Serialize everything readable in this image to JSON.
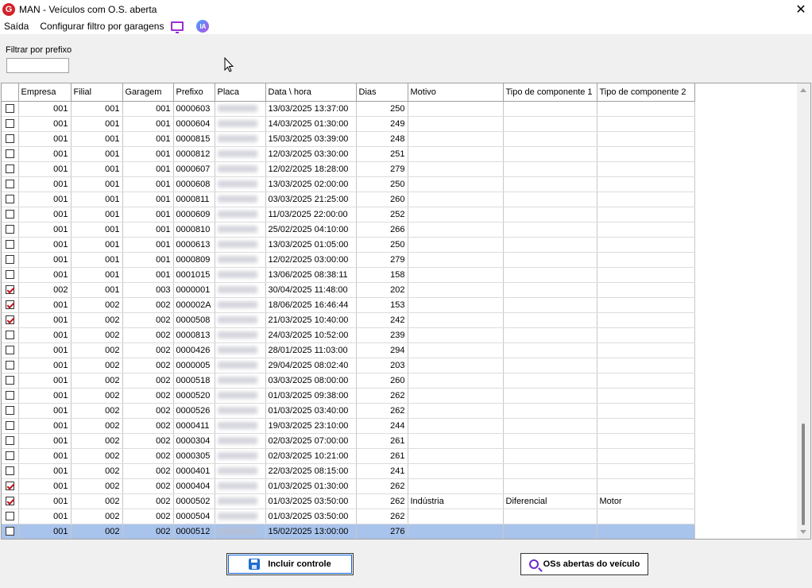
{
  "window": {
    "title": "MAN - Veículos com O.S. aberta",
    "logo_letter": "G"
  },
  "menu": {
    "exit": "Saída",
    "configure_filter": "Configurar filtro por garagens",
    "ia": "IA"
  },
  "filter": {
    "label": "Filtrar por prefixo",
    "value": ""
  },
  "table": {
    "columns": [
      "Empresa",
      "Filial",
      "Garagem",
      "Prefixo",
      "Placa",
      "Data \\ hora",
      "Dias",
      "Motivo",
      "Tipo de componente 1",
      "Tipo de componente 2"
    ],
    "rows": [
      {
        "checked": false,
        "empresa": "001",
        "filial": "001",
        "garagem": "001",
        "prefixo": "0000603",
        "data": "13/03/2025 13:37:00",
        "dias": "250",
        "motivo": "",
        "comp1": "",
        "comp2": ""
      },
      {
        "checked": false,
        "empresa": "001",
        "filial": "001",
        "garagem": "001",
        "prefixo": "0000604",
        "data": "14/03/2025 01:30:00",
        "dias": "249",
        "motivo": "",
        "comp1": "",
        "comp2": ""
      },
      {
        "checked": false,
        "empresa": "001",
        "filial": "001",
        "garagem": "001",
        "prefixo": "0000815",
        "data": "15/03/2025 03:39:00",
        "dias": "248",
        "motivo": "",
        "comp1": "",
        "comp2": ""
      },
      {
        "checked": false,
        "empresa": "001",
        "filial": "001",
        "garagem": "001",
        "prefixo": "0000812",
        "data": "12/03/2025 03:30:00",
        "dias": "251",
        "motivo": "",
        "comp1": "",
        "comp2": ""
      },
      {
        "checked": false,
        "empresa": "001",
        "filial": "001",
        "garagem": "001",
        "prefixo": "0000607",
        "data": "12/02/2025 18:28:00",
        "dias": "279",
        "motivo": "",
        "comp1": "",
        "comp2": ""
      },
      {
        "checked": false,
        "empresa": "001",
        "filial": "001",
        "garagem": "001",
        "prefixo": "0000608",
        "data": "13/03/2025 02:00:00",
        "dias": "250",
        "motivo": "",
        "comp1": "",
        "comp2": ""
      },
      {
        "checked": false,
        "empresa": "001",
        "filial": "001",
        "garagem": "001",
        "prefixo": "0000811",
        "data": "03/03/2025 21:25:00",
        "dias": "260",
        "motivo": "",
        "comp1": "",
        "comp2": ""
      },
      {
        "checked": false,
        "empresa": "001",
        "filial": "001",
        "garagem": "001",
        "prefixo": "0000609",
        "data": "11/03/2025 22:00:00",
        "dias": "252",
        "motivo": "",
        "comp1": "",
        "comp2": ""
      },
      {
        "checked": false,
        "empresa": "001",
        "filial": "001",
        "garagem": "001",
        "prefixo": "0000810",
        "data": "25/02/2025 04:10:00",
        "dias": "266",
        "motivo": "",
        "comp1": "",
        "comp2": ""
      },
      {
        "checked": false,
        "empresa": "001",
        "filial": "001",
        "garagem": "001",
        "prefixo": "0000613",
        "data": "13/03/2025 01:05:00",
        "dias": "250",
        "motivo": "",
        "comp1": "",
        "comp2": ""
      },
      {
        "checked": false,
        "empresa": "001",
        "filial": "001",
        "garagem": "001",
        "prefixo": "0000809",
        "data": "12/02/2025 03:00:00",
        "dias": "279",
        "motivo": "",
        "comp1": "",
        "comp2": ""
      },
      {
        "checked": false,
        "empresa": "001",
        "filial": "001",
        "garagem": "001",
        "prefixo": "0001015",
        "data": "13/06/2025 08:38:11",
        "dias": "158",
        "motivo": "",
        "comp1": "",
        "comp2": ""
      },
      {
        "checked": true,
        "empresa": "002",
        "filial": "001",
        "garagem": "003",
        "prefixo": "0000001",
        "data": "30/04/2025 11:48:00",
        "dias": "202",
        "motivo": "",
        "comp1": "",
        "comp2": ""
      },
      {
        "checked": true,
        "empresa": "001",
        "filial": "002",
        "garagem": "002",
        "prefixo": "000002A",
        "data": "18/06/2025 16:46:44",
        "dias": "153",
        "motivo": "",
        "comp1": "",
        "comp2": ""
      },
      {
        "checked": true,
        "empresa": "001",
        "filial": "002",
        "garagem": "002",
        "prefixo": "0000508",
        "data": "21/03/2025 10:40:00",
        "dias": "242",
        "motivo": "",
        "comp1": "",
        "comp2": ""
      },
      {
        "checked": false,
        "empresa": "001",
        "filial": "002",
        "garagem": "002",
        "prefixo": "0000813",
        "data": "24/03/2025 10:52:00",
        "dias": "239",
        "motivo": "",
        "comp1": "",
        "comp2": ""
      },
      {
        "checked": false,
        "empresa": "001",
        "filial": "002",
        "garagem": "002",
        "prefixo": "0000426",
        "data": "28/01/2025 11:03:00",
        "dias": "294",
        "motivo": "",
        "comp1": "",
        "comp2": ""
      },
      {
        "checked": false,
        "empresa": "001",
        "filial": "002",
        "garagem": "002",
        "prefixo": "0000005",
        "data": "29/04/2025 08:02:40",
        "dias": "203",
        "motivo": "",
        "comp1": "",
        "comp2": ""
      },
      {
        "checked": false,
        "empresa": "001",
        "filial": "002",
        "garagem": "002",
        "prefixo": "0000518",
        "data": "03/03/2025 08:00:00",
        "dias": "260",
        "motivo": "",
        "comp1": "",
        "comp2": ""
      },
      {
        "checked": false,
        "empresa": "001",
        "filial": "002",
        "garagem": "002",
        "prefixo": "0000520",
        "data": "01/03/2025 09:38:00",
        "dias": "262",
        "motivo": "",
        "comp1": "",
        "comp2": ""
      },
      {
        "checked": false,
        "empresa": "001",
        "filial": "002",
        "garagem": "002",
        "prefixo": "0000526",
        "data": "01/03/2025 03:40:00",
        "dias": "262",
        "motivo": "",
        "comp1": "",
        "comp2": ""
      },
      {
        "checked": false,
        "empresa": "001",
        "filial": "002",
        "garagem": "002",
        "prefixo": "0000411",
        "data": "19/03/2025 23:10:00",
        "dias": "244",
        "motivo": "",
        "comp1": "",
        "comp2": ""
      },
      {
        "checked": false,
        "empresa": "001",
        "filial": "002",
        "garagem": "002",
        "prefixo": "0000304",
        "data": "02/03/2025 07:00:00",
        "dias": "261",
        "motivo": "",
        "comp1": "",
        "comp2": ""
      },
      {
        "checked": false,
        "empresa": "001",
        "filial": "002",
        "garagem": "002",
        "prefixo": "0000305",
        "data": "02/03/2025 10:21:00",
        "dias": "261",
        "motivo": "",
        "comp1": "",
        "comp2": ""
      },
      {
        "checked": false,
        "empresa": "001",
        "filial": "002",
        "garagem": "002",
        "prefixo": "0000401",
        "data": "22/03/2025 08:15:00",
        "dias": "241",
        "motivo": "",
        "comp1": "",
        "comp2": ""
      },
      {
        "checked": true,
        "empresa": "001",
        "filial": "002",
        "garagem": "002",
        "prefixo": "0000404",
        "data": "01/03/2025 01:30:00",
        "dias": "262",
        "motivo": "",
        "comp1": "",
        "comp2": ""
      },
      {
        "checked": true,
        "empresa": "001",
        "filial": "002",
        "garagem": "002",
        "prefixo": "0000502",
        "data": "01/03/2025 03:50:00",
        "dias": "262",
        "motivo": "Indústria",
        "comp1": "Diferencial",
        "comp2": "Motor"
      },
      {
        "checked": false,
        "empresa": "001",
        "filial": "002",
        "garagem": "002",
        "prefixo": "0000504",
        "data": "01/03/2025 03:50:00",
        "dias": "262",
        "motivo": "",
        "comp1": "",
        "comp2": ""
      },
      {
        "checked": false,
        "empresa": "001",
        "filial": "002",
        "garagem": "002",
        "prefixo": "0000512",
        "data": "15/02/2025 13:00:00",
        "dias": "276",
        "motivo": "",
        "comp1": "",
        "comp2": "",
        "selected": true
      }
    ]
  },
  "buttons": {
    "include": "Incluir controle",
    "open_os": "OSs abertas do veículo"
  },
  "colors": {
    "selection": "#a9c4ec",
    "check": "#c0121c",
    "accent": "#0c5fd6"
  }
}
